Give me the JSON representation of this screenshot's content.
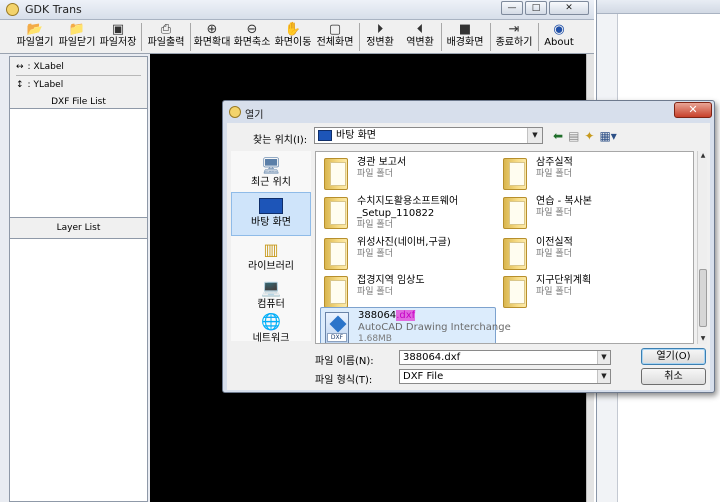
{
  "app": {
    "title": "GDK Trans",
    "window_buttons": [
      "—",
      "□",
      "✕"
    ]
  },
  "toolbar": {
    "buttons": [
      {
        "label": "파일열기",
        "icon": "open-file-icon"
      },
      {
        "label": "파일닫기",
        "icon": "close-file-icon"
      },
      {
        "label": "파일저장",
        "icon": "save-icon"
      },
      {
        "label": "파일출력",
        "icon": "print-icon"
      },
      {
        "label": "화면확대",
        "icon": "zoom-in-icon"
      },
      {
        "label": "화면축소",
        "icon": "zoom-out-icon"
      },
      {
        "label": "화면이동",
        "icon": "hand-icon"
      },
      {
        "label": "전체화면",
        "icon": "full-screen-icon"
      },
      {
        "label": "정변환",
        "icon": "forward-transform-icon"
      },
      {
        "label": "역변환",
        "icon": "inverse-transform-icon"
      },
      {
        "label": "배경화면",
        "icon": "background-icon"
      },
      {
        "label": "종료하기",
        "icon": "exit-icon"
      },
      {
        "label": "About",
        "icon": "about-icon"
      }
    ]
  },
  "left_panel": {
    "xlabel": ": XLabel",
    "ylabel": ": YLabel",
    "dxf_file_list": "DXF File List",
    "layer_list": "Layer List"
  },
  "dialog": {
    "title": "열기",
    "close": "✕",
    "look_in_label": "찾는 위치(I):",
    "look_in_value": "바탕 화면",
    "places": [
      {
        "label": "최근 위치",
        "icon": "recent-places-icon"
      },
      {
        "label": "바탕 화면",
        "icon": "desktop-icon",
        "selected": true
      },
      {
        "label": "라이브러리",
        "icon": "libraries-icon"
      },
      {
        "label": "컴퓨터",
        "icon": "computer-icon"
      },
      {
        "label": "네트워크",
        "icon": "network-icon"
      }
    ],
    "files": [
      {
        "name": "경관 보고서",
        "type": "파일 폴더"
      },
      {
        "name": "삼주실적",
        "type": "파일 폴더"
      },
      {
        "name": "수치지도활용소프트웨어",
        "name2": "_Setup_110822",
        "type": "파일 폴더"
      },
      {
        "name": "연습 - 복사본",
        "type": "파일 폴더"
      },
      {
        "name": "위성사진(네이버,구글)",
        "type": "파일 폴더"
      },
      {
        "name": "이전실적",
        "type": "파일 폴더"
      },
      {
        "name": "접경지역 임상도",
        "type": "파일 폴더"
      },
      {
        "name": "지구단위계획",
        "type": "파일 폴더"
      }
    ],
    "selected_file": {
      "name_base": "388064",
      "name_ext": ".dxf",
      "description": "AutoCAD Drawing Interchange",
      "size": "1.68MB",
      "icon_tag": "DXF"
    },
    "filename_label": "파일 이름(N):",
    "filename_value": "388064.dxf",
    "filetype_label": "파일 형식(T):",
    "filetype_value": "DXF File",
    "open_button": "열기(O)",
    "cancel_button": "취소"
  },
  "colors": {
    "canvas": "#000000",
    "selection": "#cfe4fa",
    "highlight": "#e06ae0"
  }
}
